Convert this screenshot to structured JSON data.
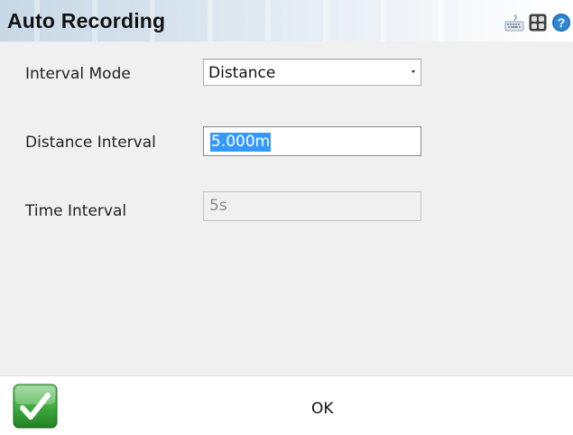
{
  "window": {
    "title": "Auto Recording"
  },
  "titlebar_icons": [
    {
      "name": "keyboard-icon"
    },
    {
      "name": "grid-icon"
    },
    {
      "name": "help-icon"
    }
  ],
  "form": {
    "interval_mode": {
      "label": "Interval Mode",
      "value": "Distance"
    },
    "distance_interval": {
      "label": "Distance Interval",
      "value": "5.000m"
    },
    "time_interval": {
      "label": "Time Interval",
      "value": "5s",
      "enabled": false
    }
  },
  "footer": {
    "ok_label": "OK",
    "ok_icon": "checkmark-icon",
    "accent": "#2e9d2e"
  },
  "colors": {
    "selection": "#3399ff",
    "background": "#f0f0f0"
  }
}
